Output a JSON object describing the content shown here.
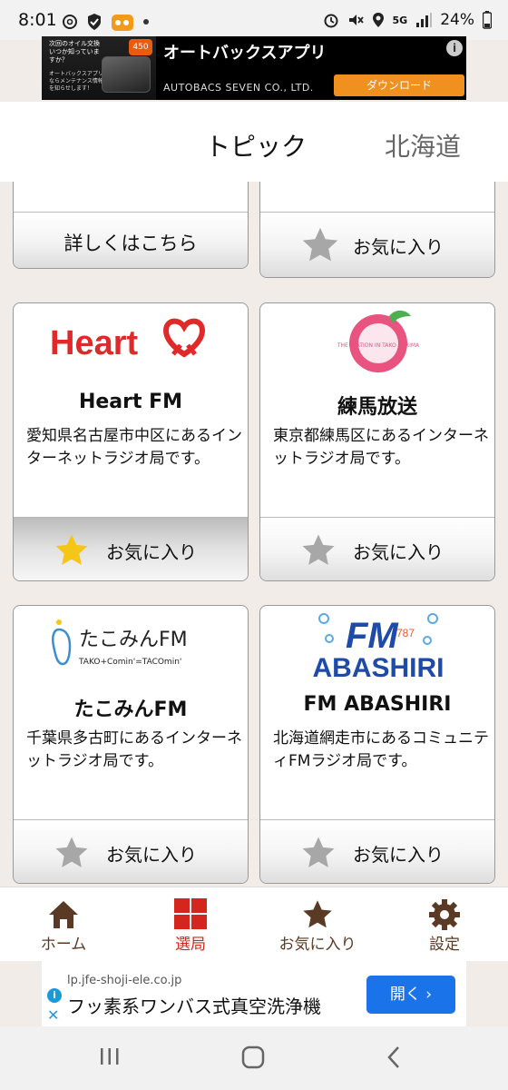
{
  "status_bar": {
    "time": "8:01",
    "network": "5G",
    "battery": "24%",
    "icons": [
      "threads-icon",
      "shield-check-icon",
      "app-badge-icon",
      "dot-icon",
      "alarm-icon",
      "mute-icon",
      "location-icon",
      "signal-icon",
      "battery-icon"
    ]
  },
  "ad_top": {
    "badge": "450",
    "thumb_text": "次回のオイル交換いつか知っていますか？",
    "thumb_sub": "オートバックスアプリならメンテナンス情報を知らせします！",
    "title": "オートバックスアプリ",
    "advertiser": "AUTOBACS SEVEN CO., LTD.",
    "button": "ダウンロード",
    "info": "i"
  },
  "tabs": [
    {
      "label": "トピック",
      "active": true
    },
    {
      "label": "北海道",
      "active": false
    }
  ],
  "partial_cards": [
    {
      "button_label": "詳しくはこちら",
      "has_star": false
    },
    {
      "button_label": "お気に入り",
      "has_star": true
    }
  ],
  "stations": [
    {
      "name": "Heart FM",
      "logo_text": "Heart",
      "description": "愛知県名古屋市中区にあるインターネットラジオ局です。",
      "favorite_label": "お気に入り",
      "is_favorite": true
    },
    {
      "name": "練馬放送",
      "logo_text": "THE STATION IN TAKO NERIMA",
      "description": "東京都練馬区にあるインターネットラジオ局です。",
      "favorite_label": "お気に入り",
      "is_favorite": false
    },
    {
      "name": "たこみんFM",
      "logo_text": "たこみんFM",
      "logo_sub": "TAKO+Comin'=TACOmin'",
      "description": "千葉県多古町にあるインターネットラジオ局です。",
      "favorite_label": "お気に入り",
      "is_favorite": false
    },
    {
      "name": "FM ABASHIRI",
      "logo_text": "ABASHIRI",
      "logo_sub": "787",
      "description": "北海道網走市にあるコミュニティFMラジオ局です。",
      "favorite_label": "お気に入り",
      "is_favorite": false
    }
  ],
  "bottom_nav": [
    {
      "label": "ホーム",
      "icon": "home-icon",
      "active": false
    },
    {
      "label": "選局",
      "icon": "grid-icon",
      "active": true
    },
    {
      "label": "お気に入り",
      "icon": "star-icon",
      "active": false
    },
    {
      "label": "設定",
      "icon": "gear-icon",
      "active": false
    }
  ],
  "ad_bottom": {
    "url": "lp.jfe-shoji-ele.co.jp",
    "headline": "フッ素系ワンバス式真空洗浄機",
    "button": "開く"
  },
  "colors": {
    "accent_red": "#d4261c",
    "brown": "#5a3a25",
    "star_gold": "#f5c518",
    "star_gray": "#a7a7a7",
    "ad_blue": "#1a73e8"
  }
}
